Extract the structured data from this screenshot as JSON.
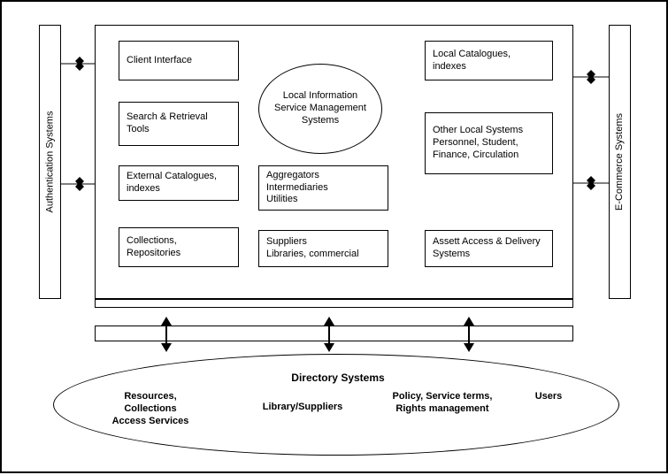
{
  "left_panel": {
    "label": "Authentication Systems"
  },
  "right_panel": {
    "label": "E-Commerce Systems"
  },
  "center_circle": {
    "label": "Local Information Service Management Systems"
  },
  "boxes": {
    "client_interface": "Client Interface",
    "search_tools": "Search & Retrieval Tools",
    "external_catalogues": "External Catalogues, indexes",
    "collections": "Collections, Repositories",
    "aggregators": "Aggregators\nIntermediaries\nUtilities",
    "suppliers": "Suppliers\nLibraries, commercial",
    "local_catalogues": "Local Catalogues, indexes",
    "other_local": "Other Local Systems Personnel, Student, Finance, Circulation",
    "asset_access": "Assett Access & Delivery Systems"
  },
  "directory": {
    "title": "Directory Systems",
    "items": {
      "resources": "Resources, Collections\nAccess Services",
      "library_suppliers": "Library/Suppliers",
      "policy": "Policy, Service terms,\nRights management",
      "users": "Users"
    }
  }
}
